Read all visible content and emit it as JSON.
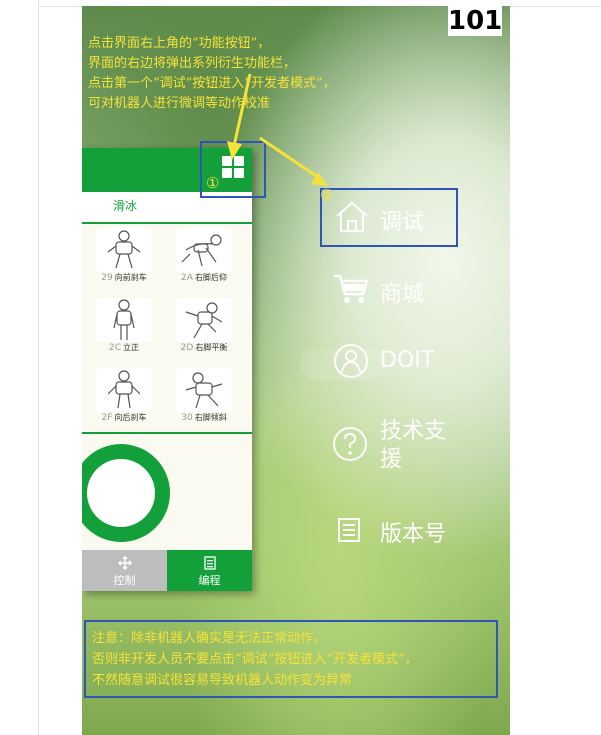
{
  "page_number": "101",
  "instruction": {
    "line1": "点击界面右上角的“功能按钮”，",
    "line2": "界面的右边将弹出系列衍生功能栏，",
    "line3": "点击第一个“调试”按钮进入“开发者模式”，",
    "line4": "可对机器人进行微调等动作校准"
  },
  "markers": {
    "one": "①",
    "two": "②"
  },
  "app": {
    "tab": "滑冰",
    "actions": [
      {
        "code": "29",
        "label": "向前刹车"
      },
      {
        "code": "2A",
        "label": "右脚后仰"
      },
      {
        "code": "2C",
        "label": "立正"
      },
      {
        "code": "2D",
        "label": "右脚平衡"
      },
      {
        "code": "2F",
        "label": "向后刹车"
      },
      {
        "code": "30",
        "label": "右脚倾斜"
      }
    ],
    "bottom_tabs": {
      "control": "控制",
      "program": "编程"
    }
  },
  "menu": {
    "debug": "调试",
    "store": "商城",
    "doit": "DOIT",
    "support_line1": "技术支",
    "support_line2": "援",
    "version": "版本号"
  },
  "note": {
    "line1": "注意：除非机器人确实是无法正常动作，",
    "line2": "否则非开发人员不要点击“调试”按钮进入“开发者模式”，",
    "line3": "不然随意调试很容易导致机器人动作变为异常"
  },
  "colors": {
    "app_green": "#13a03a",
    "annotation_yellow": "#f5e23a",
    "box_blue": "#2f55b7"
  }
}
